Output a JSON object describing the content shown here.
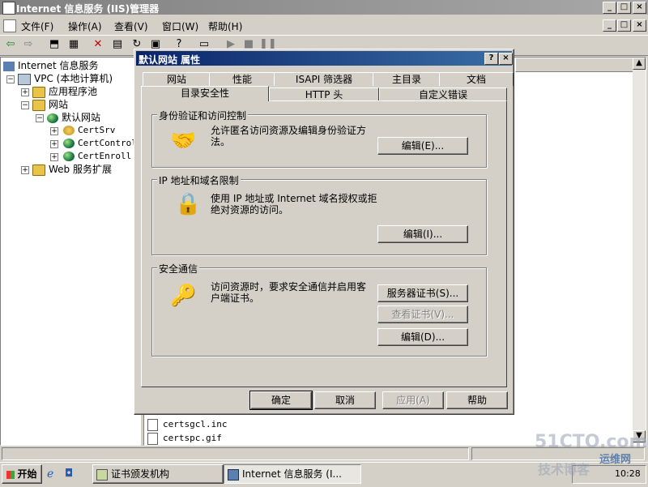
{
  "app": {
    "title": "Internet 信息服务 (IIS)管理器",
    "caption_buttons": [
      "_",
      "□",
      "×"
    ]
  },
  "menubar": {
    "items": [
      "文件(F)",
      "操作(A)",
      "查看(V)",
      "窗口(W)",
      "帮助(H)"
    ]
  },
  "toolbar": {
    "icons": [
      "back-icon",
      "forward-icon",
      "up-folder-icon",
      "show-tree-icon",
      "delete-icon",
      "properties-icon",
      "refresh-icon",
      "export-icon",
      "help-icon",
      "computer-icon",
      "play-icon",
      "stop-icon",
      "pause-icon"
    ]
  },
  "tree": {
    "root": "Internet 信息服务",
    "computer": "VPC (本地计算机)",
    "app_pools": "应用程序池",
    "websites": "网站",
    "default_site": "默认网站",
    "children": [
      "CertSrv",
      "CertControl",
      "CertEnroll"
    ],
    "web_ext": "Web 服务扩展"
  },
  "files": [
    "certsgcl.inc",
    "certspc.gif"
  ],
  "dialog": {
    "title": "默认网站 属性",
    "help_button": "?",
    "close_button": "×",
    "tabs_back": [
      "网站",
      "性能",
      "ISAPI 筛选器",
      "主目录",
      "文档"
    ],
    "tabs_front": [
      "目录安全性",
      "HTTP 头",
      "自定义错误"
    ],
    "active_tab": "目录安全性",
    "auth": {
      "group": "身份验证和访问控制",
      "desc": "允许匿名访问资源及编辑身份验证方法。",
      "edit": "编辑(E)..."
    },
    "ip": {
      "group": "IP 地址和域名限制",
      "desc": "使用 IP 地址或 Internet 域名授权或拒绝对资源的访问。",
      "edit": "编辑(I)..."
    },
    "secure": {
      "group": "安全通信",
      "desc": "访问资源时，要求安全通信并启用客户端证书。",
      "server_cert": "服务器证书(S)...",
      "view_cert": "查看证书(V)...",
      "edit": "编辑(D)..."
    },
    "buttons": {
      "ok": "确定",
      "cancel": "取消",
      "apply": "应用(A)",
      "help": "帮助"
    }
  },
  "taskbar": {
    "start": "开始",
    "tasks": [
      "证书颁发机构",
      "Internet 信息服务 (I..."
    ],
    "clock": "10:28"
  },
  "watermark": {
    "line1": "51CTO.com",
    "line2": "技术博客",
    "line3": "运维网"
  },
  "colors": {
    "active_title": "#0a246a",
    "inactive_title": "#808080",
    "face": "#d4d0c8"
  }
}
